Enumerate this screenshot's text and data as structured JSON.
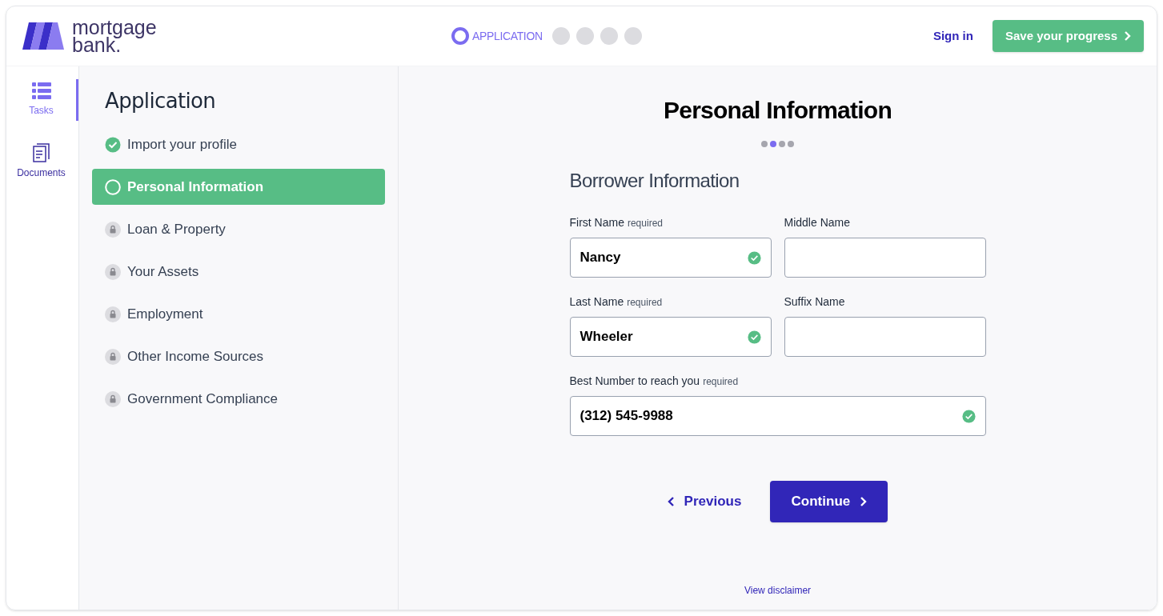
{
  "logo": {
    "line_1": "mortgage",
    "line_2": "bank."
  },
  "progress_steps": [
    {
      "label": "APPLICATION",
      "selected": true
    },
    {
      "selected": false
    },
    {
      "selected": false
    },
    {
      "selected": false
    },
    {
      "selected": false
    }
  ],
  "header_actions": {
    "sign_in": "Sign in",
    "save": "Save your progress"
  },
  "nav_rail": [
    {
      "kind": "tasks",
      "label": "Tasks",
      "selected": true
    },
    {
      "kind": "documents",
      "label": "Documents",
      "selected": false
    }
  ],
  "tasks": {
    "title": "Application",
    "items": [
      {
        "kind": "done",
        "label": "Import your profile",
        "selected": false
      },
      {
        "kind": "current",
        "label": "Personal Information",
        "selected": true
      },
      {
        "kind": "locked",
        "label": "Loan & Property",
        "selected": false
      },
      {
        "kind": "locked",
        "label": "Your Assets",
        "selected": false
      },
      {
        "kind": "locked",
        "label": "Employment",
        "selected": false
      },
      {
        "kind": "locked",
        "label": "Other Income Sources",
        "selected": false
      },
      {
        "kind": "locked",
        "label": "Government Compliance",
        "selected": false
      }
    ]
  },
  "form": {
    "title": "Personal Information",
    "page_dots": [
      {
        "selected": false
      },
      {
        "selected": true
      },
      {
        "selected": false
      },
      {
        "selected": false
      }
    ],
    "section": "Borrower Information",
    "fields": [
      {
        "kind": "half",
        "label": "First Name",
        "required": "required",
        "value": "Nancy",
        "valid": true
      },
      {
        "kind": "half",
        "label": "Middle Name",
        "valid": false
      },
      {
        "kind": "half",
        "label": "Last Name",
        "required": "required",
        "value": "Wheeler",
        "valid": true
      },
      {
        "kind": "half",
        "label": "Suffix Name",
        "valid": false
      },
      {
        "kind": "full",
        "label": "Best Number to reach you",
        "required": "required",
        "value": "(312) 545-9988",
        "valid": true
      }
    ],
    "previous": "Previous",
    "continue": "Continue",
    "disclaimer": "View disclaimer"
  }
}
